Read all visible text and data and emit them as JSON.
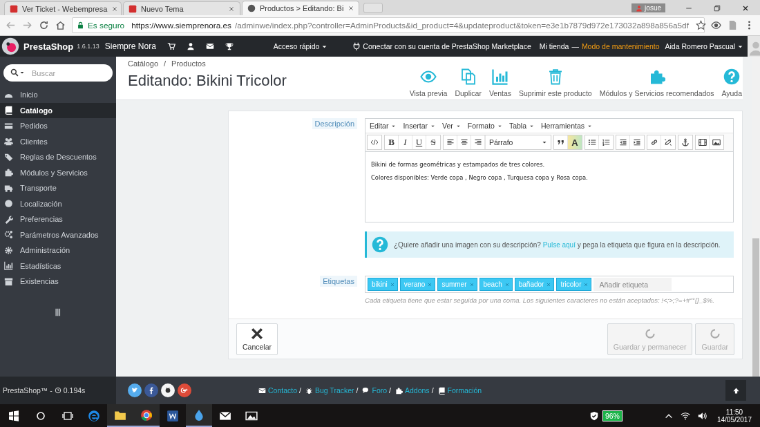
{
  "browser": {
    "tabs": [
      {
        "title": "Ver Ticket - Webempresa",
        "selected": false
      },
      {
        "title": "Nuevo Tema",
        "selected": false
      },
      {
        "title": "Productos > Editando: Bi",
        "selected": true
      }
    ],
    "profile": "josue",
    "security": "Es seguro",
    "url_host": "https://www.siemprenora.es",
    "url_path": "/adminwe/index.php?controller=AdminProducts&id_product=4&updateproduct&token=e3e1b7879d972e173032a898a856a5df"
  },
  "header": {
    "brand": "PrestaShop",
    "version": "1.6.1.13",
    "shop": "Siempre Nora",
    "quick_access": "Acceso rápido",
    "marketplace": "Conectar con su cuenta de PrestaShop Marketplace",
    "store": "Mi tienda",
    "dash": "—",
    "maintenance": "Modo de mantenimiento",
    "user": "Aida Romero Pascual"
  },
  "sidebar": {
    "search_placeholder": "Buscar",
    "items": [
      {
        "label": "Inicio",
        "selected": false
      },
      {
        "label": "Catálogo",
        "selected": true
      },
      {
        "label": "Pedidos",
        "selected": false
      },
      {
        "label": "Clientes",
        "selected": false
      },
      {
        "label": "Reglas de Descuentos",
        "selected": false
      },
      {
        "label": "Módulos y Servicios",
        "selected": false
      },
      {
        "label": "Transporte",
        "selected": false
      },
      {
        "label": "Localización",
        "selected": false
      },
      {
        "label": "Preferencias",
        "selected": false
      },
      {
        "label": "Parámetros Avanzados",
        "selected": false
      },
      {
        "label": "Administración",
        "selected": false
      },
      {
        "label": "Estadísticas",
        "selected": false
      },
      {
        "label": "Existencias",
        "selected": false
      }
    ]
  },
  "breadcrumb": {
    "items": [
      "Catálogo",
      "Productos"
    ],
    "separator": "/"
  },
  "title": "Editando: Bikini Tricolor",
  "toolbar": [
    "Vista previa",
    "Duplicar",
    "Ventas",
    "Suprimir este producto",
    "Módulos y Servicios recomendados",
    "Ayuda"
  ],
  "description": {
    "label": "Descripción",
    "menus": [
      "Editar",
      "Insertar",
      "Ver",
      "Formato",
      "Tabla",
      "Herramientas"
    ],
    "format_letters": [
      "B",
      "I",
      "U",
      "S"
    ],
    "block_format": "Párrafo",
    "color_letter": "A",
    "paragraphs": [
      "Bikini de formas geométricas y estampados de tres colores.",
      "Colores disponibles: Verde copa , Negro copa , Turquesa copa y Rosa copa."
    ]
  },
  "hint": {
    "before": "¿Quiere añadir una imagen con su descripción? ",
    "link": "Pulse aquí",
    "after": " y pega la etiqueta que figura en la descripción."
  },
  "tags": {
    "label": "Etiquetas",
    "items": [
      "bikini",
      "verano",
      "summer",
      "beach",
      "bañador",
      "tricolor"
    ],
    "placeholder": "Añadir etiqueta",
    "help": "Cada etiqueta tiene que estar seguida por una coma. Los siguientes caracteres no están aceptados: !<;>;?=+#\"°{}_$%."
  },
  "actions": {
    "cancel": "Cancelar",
    "buttons": [
      {
        "label": "Guardar y permanecer",
        "disabled": true
      },
      {
        "label": "Guardar",
        "disabled": true
      }
    ]
  },
  "footer": {
    "brand": "PrestaShop™ -",
    "time": "0.194s",
    "links": [
      {
        "label": "Contacto",
        "separator": "/"
      },
      {
        "label": "Bug Tracker",
        "separator": "/"
      },
      {
        "label": "Foro",
        "separator": "/"
      },
      {
        "label": "Addons",
        "separator": "/"
      },
      {
        "label": "Formación"
      }
    ]
  },
  "taskbar": {
    "battery": "96%",
    "time": "11:50",
    "date": "14/05/2017"
  }
}
